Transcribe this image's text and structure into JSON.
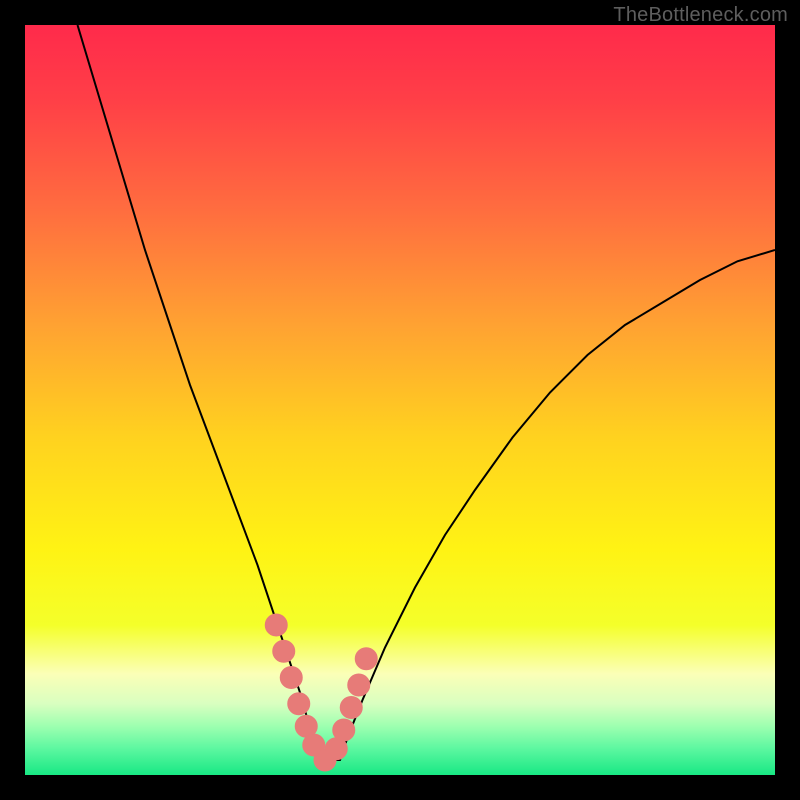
{
  "watermark": "TheBottleneck.com",
  "colors": {
    "frame": "#000000",
    "curve": "#000000",
    "marker_fill": "#e77b78",
    "marker_stroke": "#e77b78",
    "gradient_stops": [
      {
        "offset": 0.0,
        "color": "#ff2a4b"
      },
      {
        "offset": 0.1,
        "color": "#ff3f47"
      },
      {
        "offset": 0.25,
        "color": "#ff6e3f"
      },
      {
        "offset": 0.4,
        "color": "#ffa232"
      },
      {
        "offset": 0.55,
        "color": "#ffd21f"
      },
      {
        "offset": 0.7,
        "color": "#fff314"
      },
      {
        "offset": 0.8,
        "color": "#f4ff2a"
      },
      {
        "offset": 0.865,
        "color": "#fbffb7"
      },
      {
        "offset": 0.905,
        "color": "#d9ffc0"
      },
      {
        "offset": 0.935,
        "color": "#9dffb0"
      },
      {
        "offset": 0.965,
        "color": "#5cf7a0"
      },
      {
        "offset": 1.0,
        "color": "#18e884"
      }
    ]
  },
  "chart_data": {
    "type": "line",
    "title": "",
    "xlabel": "",
    "ylabel": "",
    "xlim": [
      0,
      100
    ],
    "ylim": [
      0,
      100
    ],
    "grid": false,
    "legend": false,
    "note": "Bottleneck-style V curve. y is percentage distance from optimum; minimum at x≈38–43.",
    "series": [
      {
        "name": "curve",
        "x": [
          7,
          10,
          13,
          16,
          19,
          22,
          25,
          28,
          31,
          33,
          35,
          37,
          38,
          40,
          42,
          43,
          45,
          48,
          52,
          56,
          60,
          65,
          70,
          75,
          80,
          85,
          90,
          95,
          100
        ],
        "y": [
          100,
          90,
          80,
          70,
          61,
          52,
          44,
          36,
          28,
          22,
          16,
          10,
          6,
          2,
          2,
          5,
          10,
          17,
          25,
          32,
          38,
          45,
          51,
          56,
          60,
          63,
          66,
          68.5,
          70
        ]
      }
    ],
    "markers": {
      "name": "highlight-dots",
      "x": [
        33.5,
        34.5,
        35.5,
        36.5,
        37.5,
        38.5,
        40.0,
        41.5,
        42.5,
        43.5,
        44.5,
        45.5
      ],
      "y": [
        20,
        16.5,
        13,
        9.5,
        6.5,
        4,
        2,
        3.5,
        6,
        9,
        12,
        15.5
      ]
    }
  }
}
